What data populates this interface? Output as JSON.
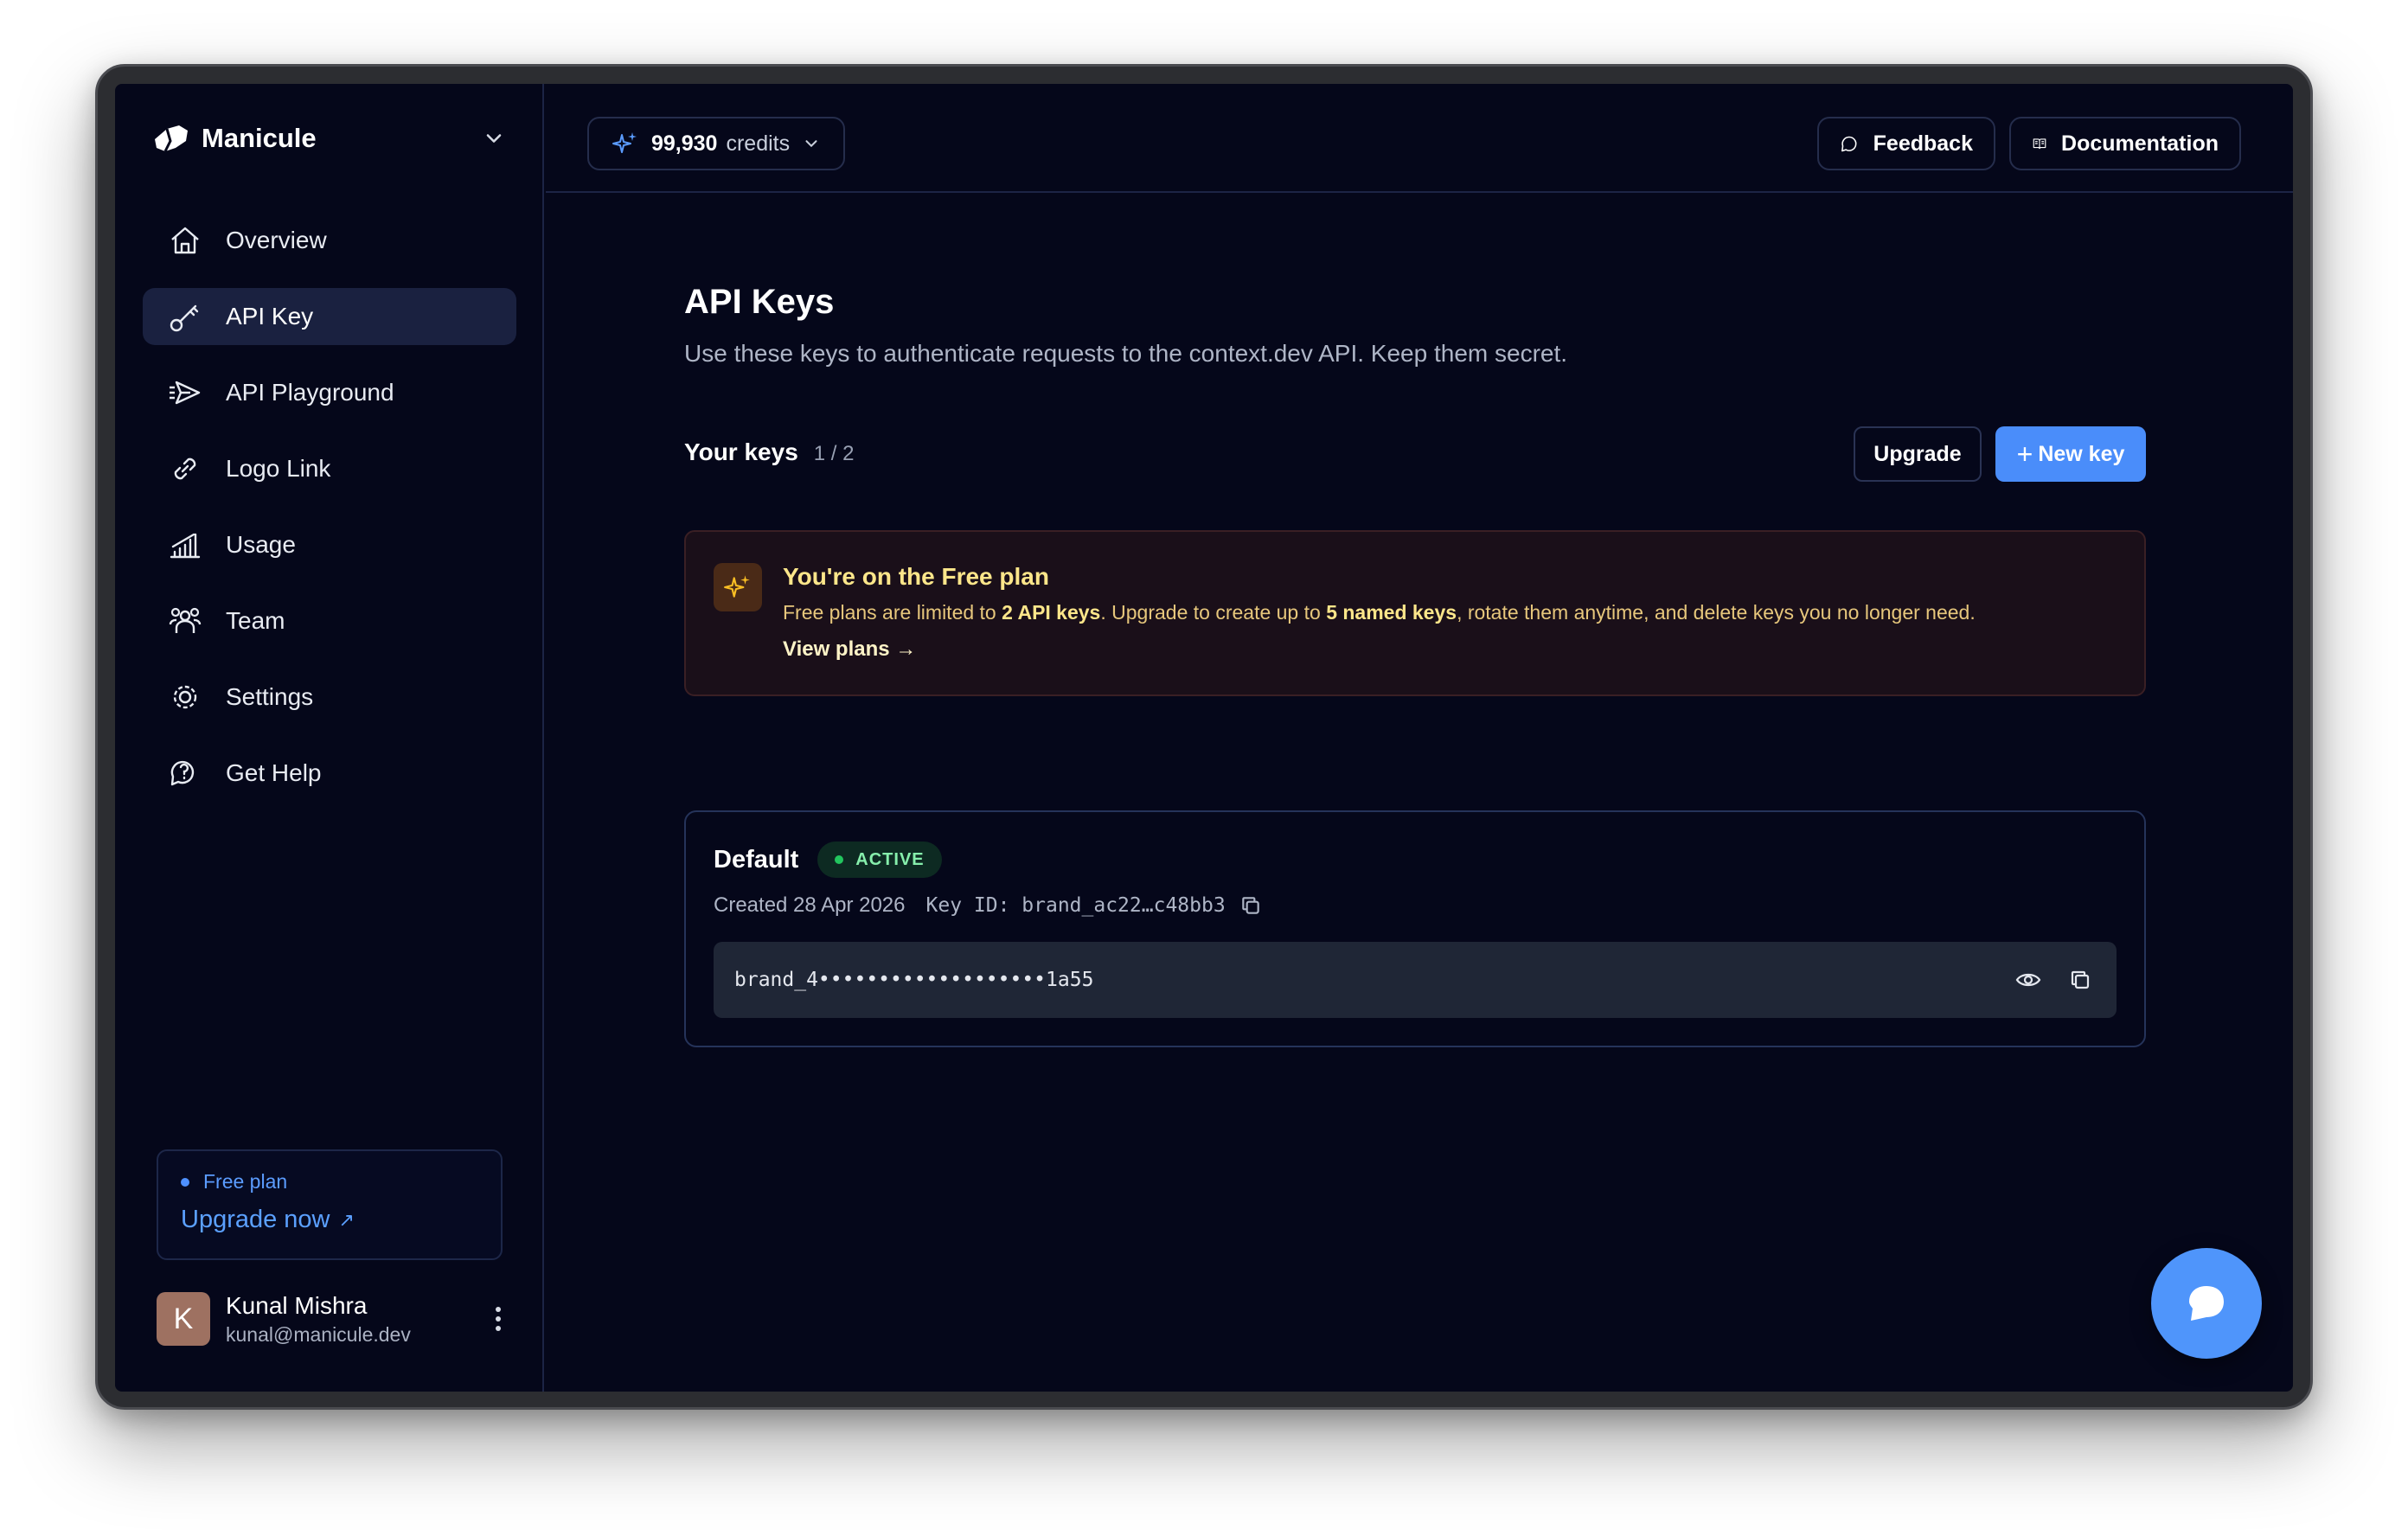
{
  "app": {
    "brand_name": "Manicule"
  },
  "sidebar": {
    "items": [
      {
        "label": "Overview",
        "icon": "home-icon",
        "active": false
      },
      {
        "label": "API Key",
        "icon": "key-icon",
        "active": true
      },
      {
        "label": "API Playground",
        "icon": "send-icon",
        "active": false
      },
      {
        "label": "Logo Link",
        "icon": "link-icon",
        "active": false
      },
      {
        "label": "Usage",
        "icon": "bar-chart-icon",
        "active": false
      },
      {
        "label": "Team",
        "icon": "team-icon",
        "active": false
      },
      {
        "label": "Settings",
        "icon": "gear-icon",
        "active": false
      },
      {
        "label": "Get Help",
        "icon": "help-chat-icon",
        "active": false
      }
    ],
    "plan": {
      "label": "Free plan",
      "cta": "Upgrade now",
      "cta_icon": "↗"
    },
    "user": {
      "initial": "K",
      "name": "Kunal Mishra",
      "email": "kunal@manicule.dev"
    }
  },
  "topbar": {
    "credits_value": "99,930",
    "credits_label": "credits",
    "feedback_label": "Feedback",
    "docs_label": "Documentation"
  },
  "main": {
    "title": "API Keys",
    "subtitle": "Use these keys to authenticate requests to the context.dev API. Keep them secret.",
    "keys_label": "Your keys",
    "keys_count": "1 / 2",
    "upgrade_label": "Upgrade",
    "new_key_label": "New key",
    "banner": {
      "title": "You're on the Free plan",
      "text_1": "Free plans are limited to ",
      "text_bold_1": "2 API keys",
      "text_2": ". Upgrade to create up to ",
      "text_bold_2": "5 named keys",
      "text_3": ", rotate them anytime, and delete keys you no longer need.",
      "link": "View plans →"
    },
    "key": {
      "name": "Default",
      "status": "ACTIVE",
      "created": "Created 28 Apr 2026",
      "key_id": "Key ID: brand_ac22…c48bb3",
      "masked_value": "brand_4•••••••••••••••••••1a55"
    }
  },
  "colors": {
    "background": "#05071a",
    "accent": "#4a8dfa",
    "banner_bg": "#1a0f19",
    "banner_text": "#fde68a",
    "status_active": "#22c55e"
  }
}
